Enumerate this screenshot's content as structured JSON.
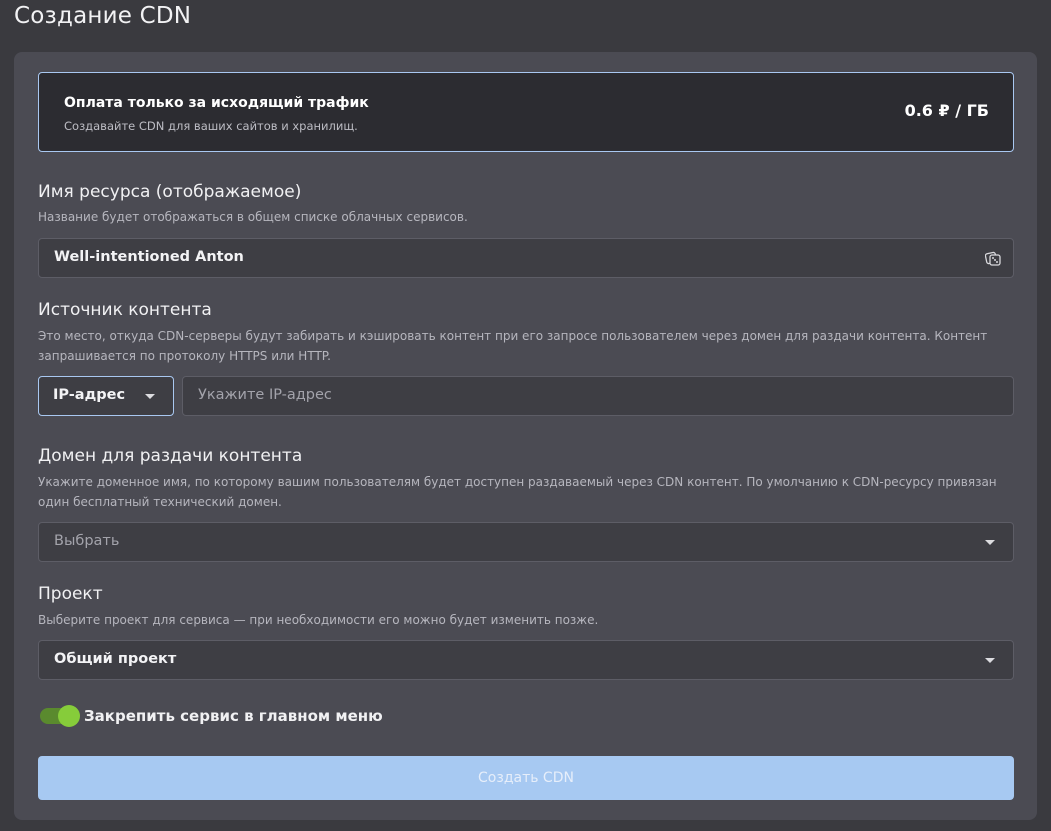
{
  "page": {
    "title": "Создание CDN"
  },
  "banner": {
    "title": "Оплата только за исходящий трафик",
    "subtitle": "Создавайте CDN для ваших сайтов и хранилищ.",
    "price": "0.6 ₽ / ГБ"
  },
  "resource_name": {
    "title": "Имя ресурса (отображаемое)",
    "description": "Название будет отображаться в общем списке облачных сервисов.",
    "value": "Well-intentioned Anton",
    "icon": "dice-icon"
  },
  "content_source": {
    "title": "Источник контента",
    "description": "Это место, откуда CDN-серверы будут забирать и кэшировать контент при его запросе пользователем через домен для раздачи контента. Контент запрашивается по протоколу HTTPS или HTTP.",
    "type_selected": "IP-адрес",
    "input_placeholder": "Укажите IP-адрес"
  },
  "domain": {
    "title": "Домен для раздачи контента",
    "description": "Укажите доменное имя, по которому вашим пользователям будет доступен раздаваемый через CDN контент. По умолчанию к CDN-ресурсу привязан один бесплатный технический домен.",
    "placeholder": "Выбрать"
  },
  "project": {
    "title": "Проект",
    "description": "Выберите проект для сервиса — при необходимости его можно будет изменить позже.",
    "selected": "Общий проект"
  },
  "pin_toggle": {
    "label": "Закрепить сервис в главном меню",
    "on": true
  },
  "submit": {
    "label": "Создать CDN"
  },
  "colors": {
    "accent_border": "#a9c8f1",
    "submit_bg": "#a7c9f2",
    "toggle_on": "#86cc3a"
  }
}
